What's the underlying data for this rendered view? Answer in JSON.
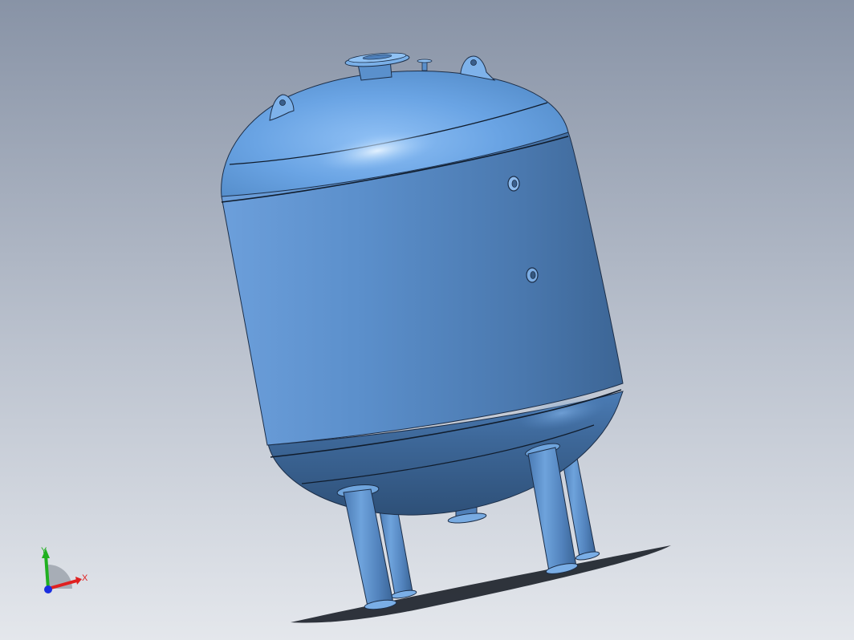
{
  "viewport": {
    "background_top": "#8a96a8",
    "background_bottom": "#e2e5ea",
    "model_color": "#5e93d0"
  },
  "triad": {
    "x_label": "X",
    "y_label": "Y",
    "x_color": "#e02020",
    "y_color": "#20b020",
    "z_color": "#1a2ee0"
  }
}
